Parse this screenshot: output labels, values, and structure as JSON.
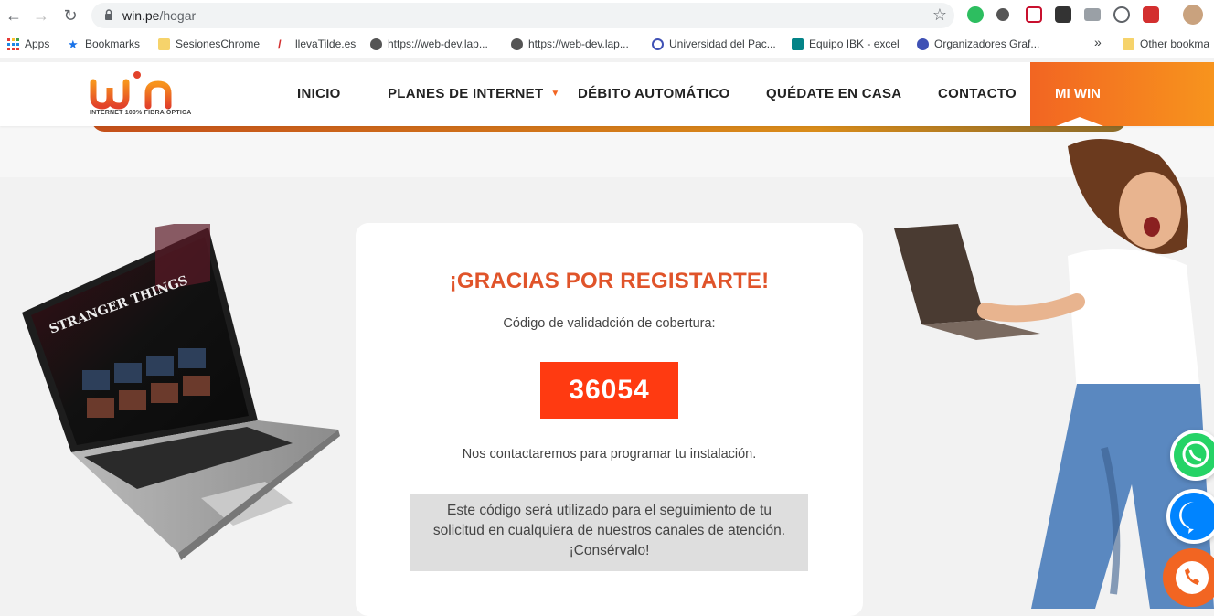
{
  "browser": {
    "url_host": "win.pe",
    "url_path": "/hogar",
    "bookmarks": [
      {
        "label": "Apps"
      },
      {
        "label": "Bookmarks"
      },
      {
        "label": "SesionesChrome"
      },
      {
        "label": "llevaTilde.es"
      },
      {
        "label": "https://web-dev.lap..."
      },
      {
        "label": "https://web-dev.lap..."
      },
      {
        "label": "Universidad del Pac..."
      },
      {
        "label": "Equipo IBK - excel"
      },
      {
        "label": "Organizadores Graf..."
      },
      {
        "label": "»"
      },
      {
        "label": "Other bookma"
      }
    ]
  },
  "site": {
    "logo_text": "win",
    "logo_subtitle": "INTERNET 100% FIBRA ÓPTICA",
    "nav": [
      {
        "label": "INICIO"
      },
      {
        "label": "PLANES DE INTERNET"
      },
      {
        "label": "DÉBITO AUTOMÁTICO"
      },
      {
        "label": "QUÉDATE EN CASA"
      },
      {
        "label": "CONTACTO"
      }
    ],
    "miwin_label": "MI WIN"
  },
  "card": {
    "title": "¡GRACIAS POR REGISTARTE!",
    "code_label": "Código de validadción de cobertura:",
    "code": "36054",
    "contact_text": "Nos contactaremos para programar tu instalación.",
    "note_line1": "Este código será utilizado para el seguimiento de tu",
    "note_line2": "solicitud en cualquiera de nuestros canales de atención.",
    "note_line3": "¡Consérvalo!"
  },
  "laptop_screen_text": "STRANGER THINGS",
  "colors": {
    "accent": "#f26522",
    "code_bg": "#ff3a11",
    "title": "#e0542a"
  }
}
